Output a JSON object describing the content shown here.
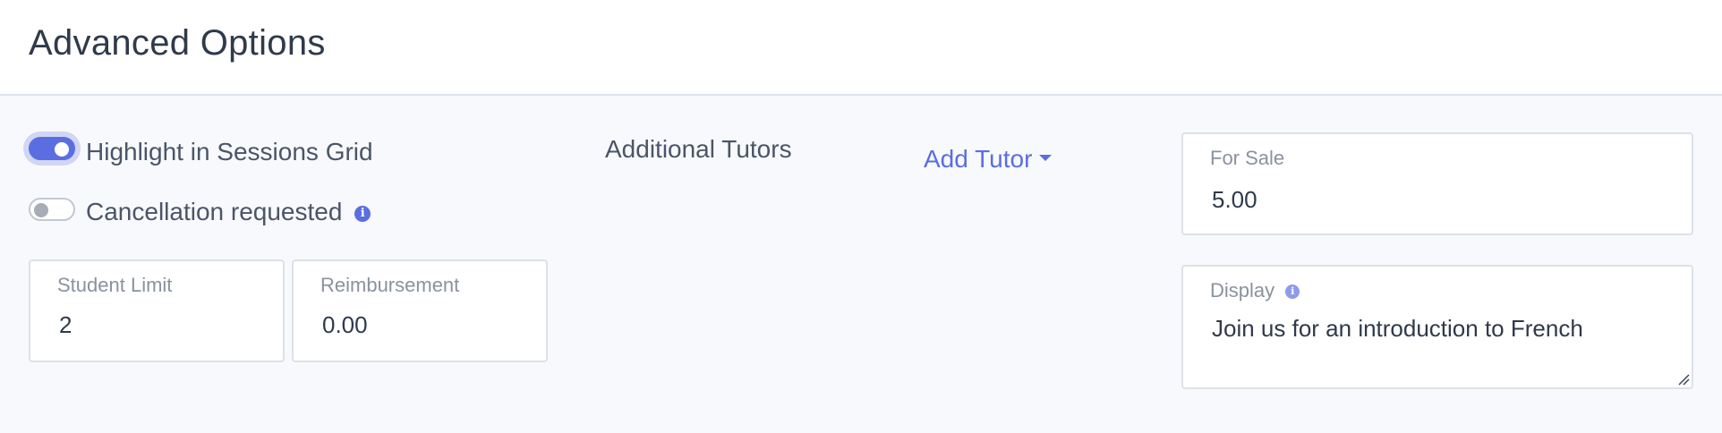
{
  "header": {
    "title": "Advanced Options"
  },
  "toggles": {
    "highlight": {
      "label": "Highlight in Sessions Grid",
      "on": true
    },
    "cancellation": {
      "label": "Cancellation requested",
      "on": false,
      "info_icon": "info-icon"
    }
  },
  "fields": {
    "student_limit": {
      "label": "Student Limit",
      "value": "2"
    },
    "reimbursement": {
      "label": "Reimbursement",
      "value": "0.00"
    },
    "for_sale": {
      "label": "For Sale",
      "value": "5.00"
    },
    "display": {
      "label": "Display",
      "value": "Join us for an introduction to French",
      "info_icon": "info-icon"
    }
  },
  "tutors": {
    "heading": "Additional Tutors",
    "add_button": "Add Tutor",
    "add_button_icon": "caret-down-icon"
  },
  "colors": {
    "accent": "#5b6ee1",
    "text": "#3a4453",
    "muted": "#8a929e",
    "border": "#dde1e8",
    "background": "#f8f9fc"
  }
}
